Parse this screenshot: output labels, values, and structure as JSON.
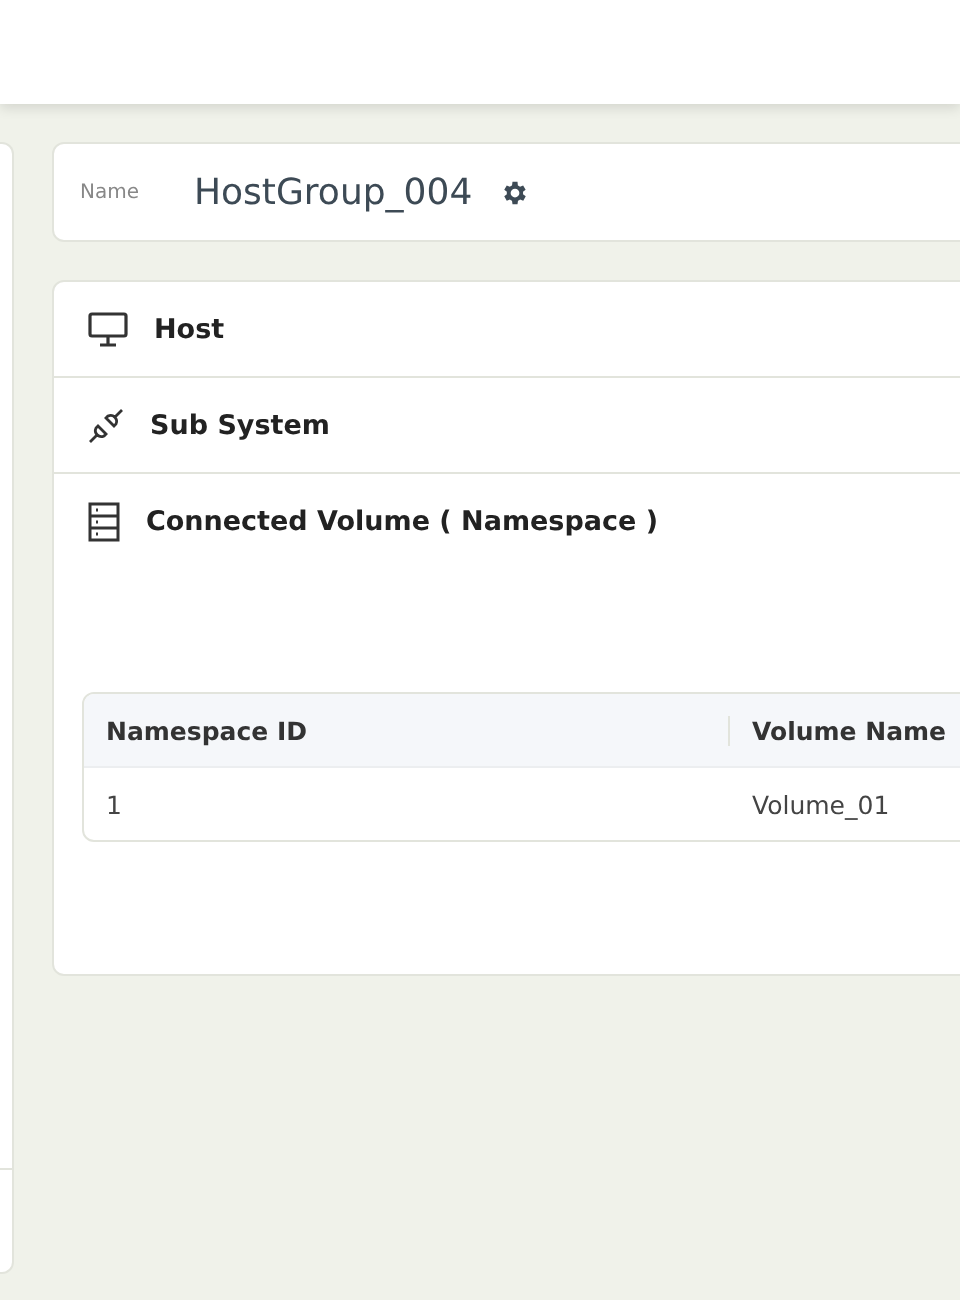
{
  "name_card": {
    "label": "Name",
    "value": "HostGroup_004"
  },
  "sections": [
    {
      "kind": "host",
      "title": "Host"
    },
    {
      "kind": "subsystem",
      "title": "Sub System"
    },
    {
      "kind": "volume",
      "title": "Connected Volume ( Namespace )"
    }
  ],
  "table": {
    "columns": [
      "Namespace ID",
      "Volume Name"
    ],
    "rows": [
      [
        "1",
        "Volume_01"
      ]
    ]
  }
}
